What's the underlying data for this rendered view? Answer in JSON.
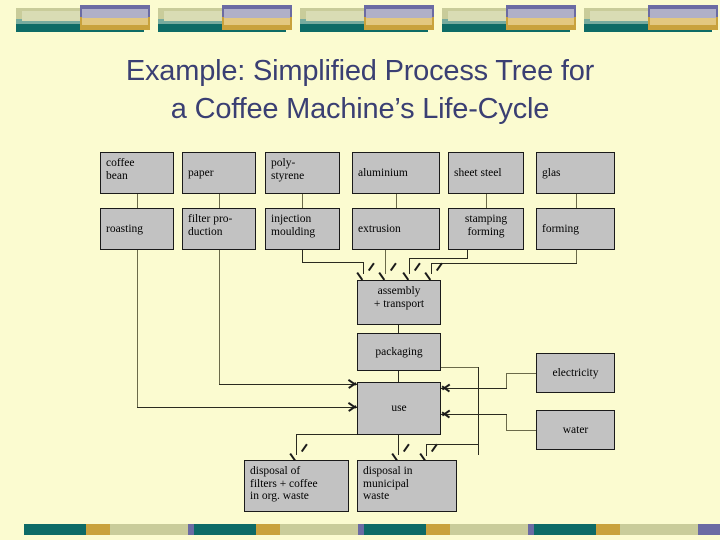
{
  "slide": {
    "title_line1": "Example: Simplified Process Tree for",
    "title_line2": "a Coffee Machine’s Life-Cycle",
    "background_color": "#fbfbd0",
    "title_color": "#3a3f73"
  },
  "decor": {
    "colors": {
      "olive": "#c9cc9a",
      "slate_blue": "#6b6ba3",
      "lavender": "#b0b0c8",
      "teal": "#0d6b66",
      "teal_light": "#77ab9e",
      "gold": "#c9a23c",
      "gold_light": "#e3c87f"
    },
    "top_unit_count": 5,
    "bottom_unit_count": 5
  },
  "diagram": {
    "node_fill": "#c2c2c2",
    "node_border": "#1a1a1a",
    "row_materials": [
      {
        "id": "coffee-bean",
        "label": "coffee\nbean"
      },
      {
        "id": "paper",
        "label": "paper"
      },
      {
        "id": "polystyrene",
        "label": "poly-\nstyrene"
      },
      {
        "id": "aluminium",
        "label": "aluminium"
      },
      {
        "id": "sheet-steel",
        "label": "sheet steel"
      },
      {
        "id": "glas",
        "label": "glas"
      }
    ],
    "row_processes": [
      {
        "id": "roasting",
        "label": "roasting"
      },
      {
        "id": "filter-production",
        "label": "filter pro-\nduction"
      },
      {
        "id": "injection-moulding",
        "label": "injection\nmoulding"
      },
      {
        "id": "extrusion",
        "label": "extrusion"
      },
      {
        "id": "stamping-forming",
        "label": "stamping\nforming"
      },
      {
        "id": "forming",
        "label": "forming"
      }
    ],
    "assembly": "assembly\n+ transport",
    "packaging": "packaging",
    "use": "use",
    "electricity": "electricity",
    "water": "water",
    "disposal_organic": "disposal of\nfilters + coffee\nin org. waste",
    "disposal_municipal": "disposal in\nmunicipal\nwaste"
  }
}
